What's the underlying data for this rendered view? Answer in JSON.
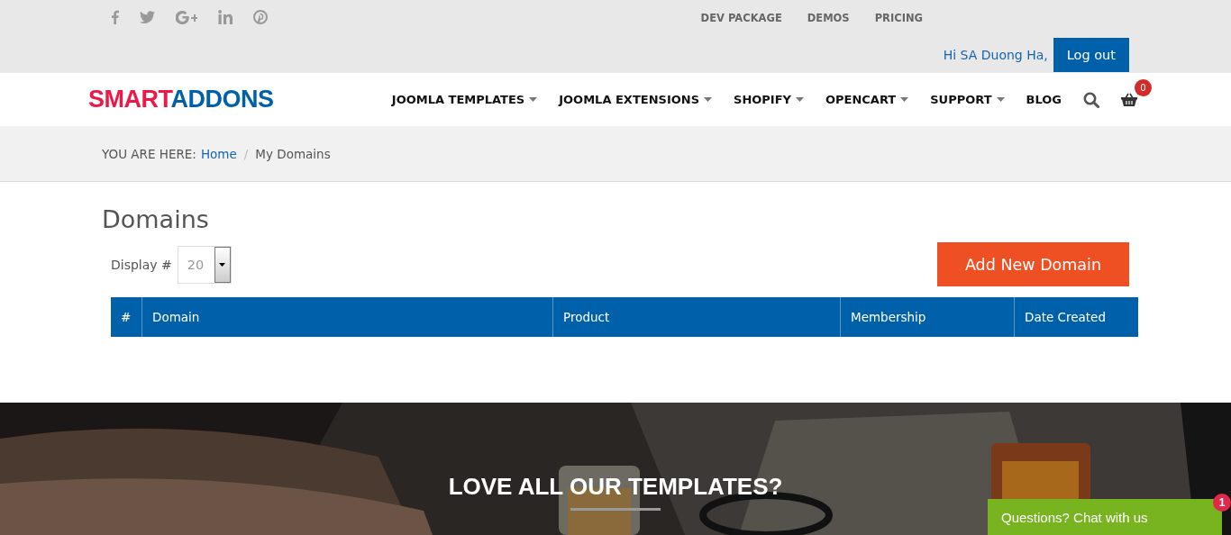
{
  "topbar": {
    "social": [
      {
        "kind": "facebook"
      },
      {
        "kind": "twitter"
      },
      {
        "kind": "googleplus"
      },
      {
        "kind": "linkedin"
      },
      {
        "kind": "pinterest"
      }
    ],
    "links": [
      "DEV PACKAGE",
      "DEMOS",
      "PRICING"
    ],
    "greeting": "Hi SA Duong Ha,",
    "logout": "Log out"
  },
  "header": {
    "logo": {
      "first": "SMART",
      "second": "ADDONS"
    },
    "nav": [
      {
        "label": "JOOMLA TEMPLATES",
        "has_dropdown": true
      },
      {
        "label": "JOOMLA EXTENSIONS",
        "has_dropdown": true
      },
      {
        "label": "SHOPIFY",
        "has_dropdown": true
      },
      {
        "label": "OPENCART",
        "has_dropdown": true
      },
      {
        "label": "SUPPORT",
        "has_dropdown": true
      },
      {
        "label": "BLOG",
        "has_dropdown": false
      }
    ],
    "cart_count": "0"
  },
  "breadcrumb": {
    "prefix": "YOU ARE HERE:",
    "separator": "/",
    "items": [
      {
        "label": "Home",
        "link": true
      },
      {
        "label": "My Domains",
        "link": false
      }
    ]
  },
  "page": {
    "title": "Domains",
    "display_label": "Display #",
    "display_value": "20",
    "add_button": "Add New Domain",
    "table": {
      "columns": [
        "#",
        "Domain",
        "Product",
        "Membership",
        "Date Created"
      ]
    }
  },
  "banner": {
    "kind": "picture",
    "heading": "LOVE ALL OUR TEMPLATES?"
  },
  "chat": {
    "label": "Questions? Chat with us",
    "badge": "1"
  }
}
